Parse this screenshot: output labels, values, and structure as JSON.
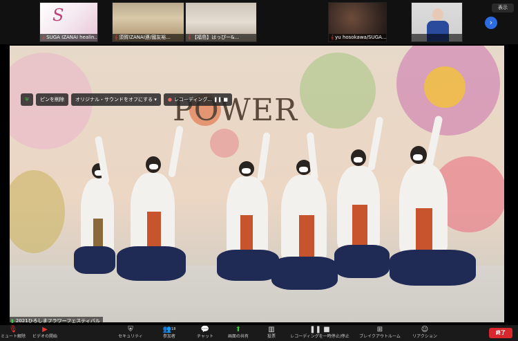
{
  "participants": [
    {
      "name": "SUGA IZANAI healin...",
      "muted": true
    },
    {
      "name": "須賀IZANAI連/國友裕...",
      "muted": true
    },
    {
      "name": "【福島】はっぴー&...",
      "muted": true
    },
    {
      "name": "yu hosokawa/SUGA...",
      "muted": true
    },
    {
      "name": "",
      "muted": false
    }
  ],
  "view_label": "表示",
  "next_icon": "chevron-right-icon",
  "share_controls": {
    "shield_icon": "shield-icon",
    "unpin_label": "ピンを削除",
    "original_sound_label": "オリジナル・サウンドをオフにする",
    "recording_label": "レコーディング..."
  },
  "banner_text": "POWER",
  "caption": "2021ひろしまフラワーフェスティバル",
  "toolbar": {
    "items": [
      {
        "icon": "mic-muted-icon",
        "label": "ミュート解除"
      },
      {
        "icon": "video-off-icon",
        "label": "ビデオの開始"
      },
      {
        "icon": "shield-icon",
        "label": "セキュリティ"
      },
      {
        "icon": "participants-icon",
        "label": "参加者",
        "badge": "18"
      },
      {
        "icon": "chat-icon",
        "label": "チャット"
      },
      {
        "icon": "share-screen-icon",
        "label": "画面の共有"
      },
      {
        "icon": "poll-icon",
        "label": "投票"
      },
      {
        "icon": "record-pause-icon",
        "label": "レコーディングを一時停止/停止"
      },
      {
        "icon": "breakout-icon",
        "label": "ブレイクアウトルーム"
      },
      {
        "icon": "reaction-icon",
        "label": "リアクション"
      }
    ],
    "end_label": "終了"
  },
  "colors": {
    "end_button": "#d8272d",
    "share_green": "#33cc33",
    "mute_red": "#ee3333",
    "next_blue": "#2d6be0"
  }
}
